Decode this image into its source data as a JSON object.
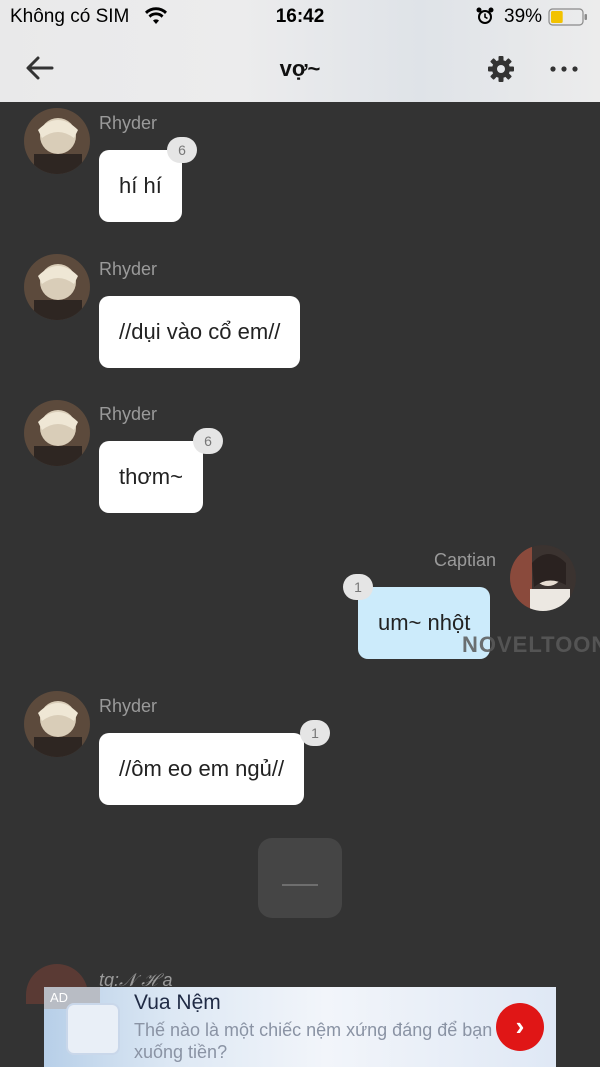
{
  "status_bar": {
    "carrier": "Không có SIM",
    "time": "16:42",
    "battery": "39%",
    "battery_level": 0.39
  },
  "header": {
    "title": "vợ~"
  },
  "messages": [
    {
      "sender": "Rhyder",
      "text": "hí hí",
      "count": "6"
    },
    {
      "sender": "Rhyder",
      "text": "//dụi vào cổ em//"
    },
    {
      "sender": "Rhyder",
      "text": "thơm~",
      "count": "6"
    },
    {
      "sender": "Captian",
      "text": "um~ nhột",
      "count": "1"
    },
    {
      "sender": "Rhyder",
      "text": "//ôm eo em ngủ//",
      "count": "1"
    }
  ],
  "partial_message": {
    "sender": "tg:𝒩 ℋ a"
  },
  "watermark": "NOVELTOON",
  "ad": {
    "tag": "AD",
    "title": "Vua Nệm",
    "description": "Thế nào là một chiếc nệm xứng đáng để bạn xuống tiền?"
  },
  "colors": {
    "background": "#333333",
    "bubble_other": "#ffffff",
    "bubble_self": "#ccebfb",
    "cta": "#e01616"
  }
}
